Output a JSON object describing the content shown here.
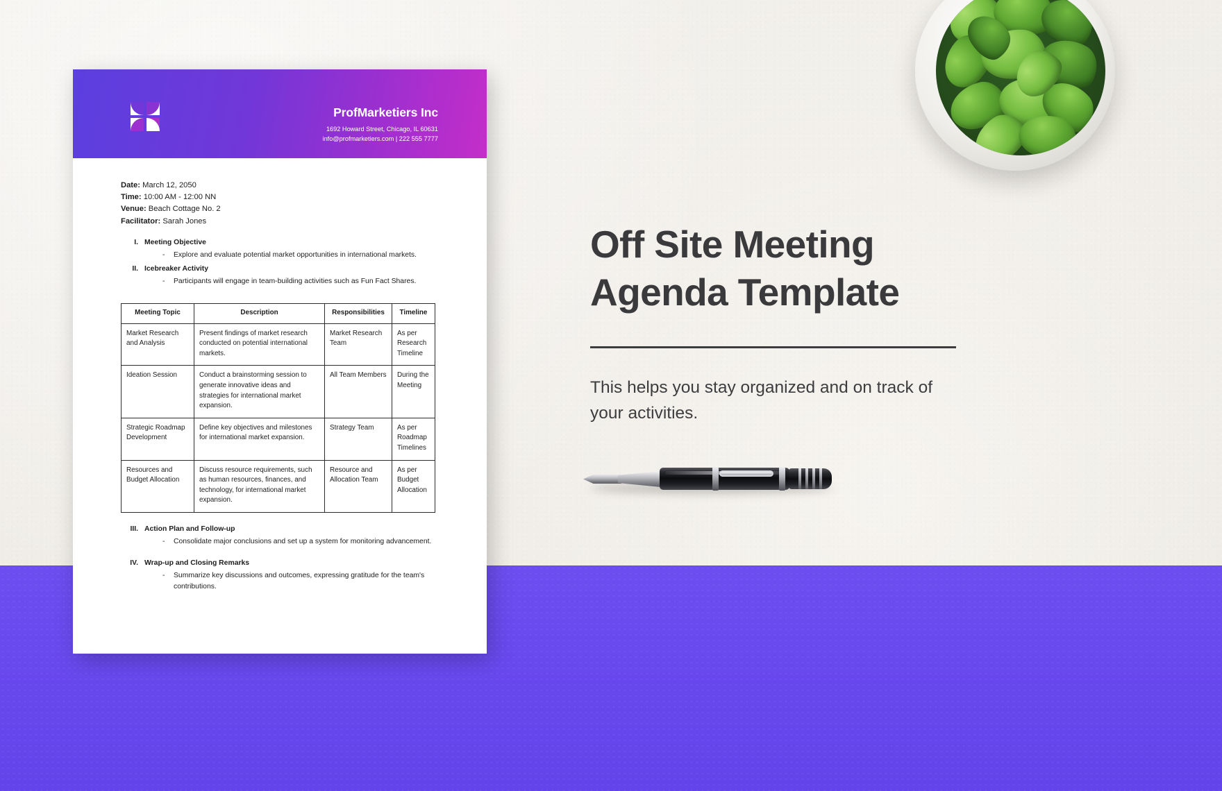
{
  "promo": {
    "title_line1": "Off Site Meeting",
    "title_line2": "Agenda Template",
    "subtitle": "This helps you stay organized and on track of your activities."
  },
  "document": {
    "header": {
      "company_name": "ProfMarketiers Inc",
      "address": "1692 Howard Street, Chicago, IL 60631",
      "contact": "info@profmarketiers.com | 222 555 7777",
      "logo_name": "profmarketiers-logo"
    },
    "meta": [
      {
        "label": "Date:",
        "value": "March 12, 2050"
      },
      {
        "label": "Time:",
        "value": "10:00 AM - 12:00 NN"
      },
      {
        "label": "Venue:",
        "value": "Beach Cottage No. 2"
      },
      {
        "label": "Facilitator:",
        "value": "Sarah Jones"
      }
    ],
    "sections_top": [
      {
        "numeral": "I.",
        "title": "Meeting Objective",
        "bullet_mark": "-",
        "bullet": "Explore and evaluate potential market opportunities in international markets."
      },
      {
        "numeral": "II.",
        "title": "Icebreaker Activity",
        "bullet_mark": "-",
        "bullet": "Participants will engage in team-building activities such as Fun Fact Shares."
      }
    ],
    "table": {
      "headers": [
        "Meeting Topic",
        "Description",
        "Responsibilities",
        "Timeline"
      ],
      "rows": [
        {
          "topic": "Market Research and Analysis",
          "description": "Present findings of market research conducted on potential international markets.",
          "responsibilities": "Market Research Team",
          "timeline": "As per Research Timeline"
        },
        {
          "topic": "Ideation Session",
          "description": "Conduct a brainstorming session to generate innovative ideas and strategies for international market expansion.",
          "responsibilities": "All Team Members",
          "timeline": "During the Meeting"
        },
        {
          "topic": "Strategic Roadmap Development",
          "description": "Define key objectives and milestones for international market expansion.",
          "responsibilities": "Strategy Team",
          "timeline": "As per Roadmap Timelines"
        },
        {
          "topic": "Resources and Budget Allocation",
          "description": "Discuss resource requirements, such as human resources, finances, and technology, for international market expansion.",
          "responsibilities": "Resource and Allocation Team",
          "timeline": "As per Budget Allocation"
        }
      ]
    },
    "sections_bottom": [
      {
        "numeral": "III.",
        "title": "Action Plan and Follow-up",
        "bullet_mark": "-",
        "bullet": "Consolidate major conclusions and set up a system for monitoring advancement."
      },
      {
        "numeral": "IV.",
        "title": "Wrap-up and Closing Remarks",
        "bullet_mark": "-",
        "bullet": "Summarize key discussions and outcomes, expressing gratitude for the team's contributions."
      }
    ]
  },
  "colors": {
    "header_gradient_start": "#5b3fe0",
    "header_gradient_end": "#c42ec9",
    "band_purple": "#6849ee",
    "page_background": "#f2f0ec",
    "text_dark": "#3a3a3c"
  }
}
